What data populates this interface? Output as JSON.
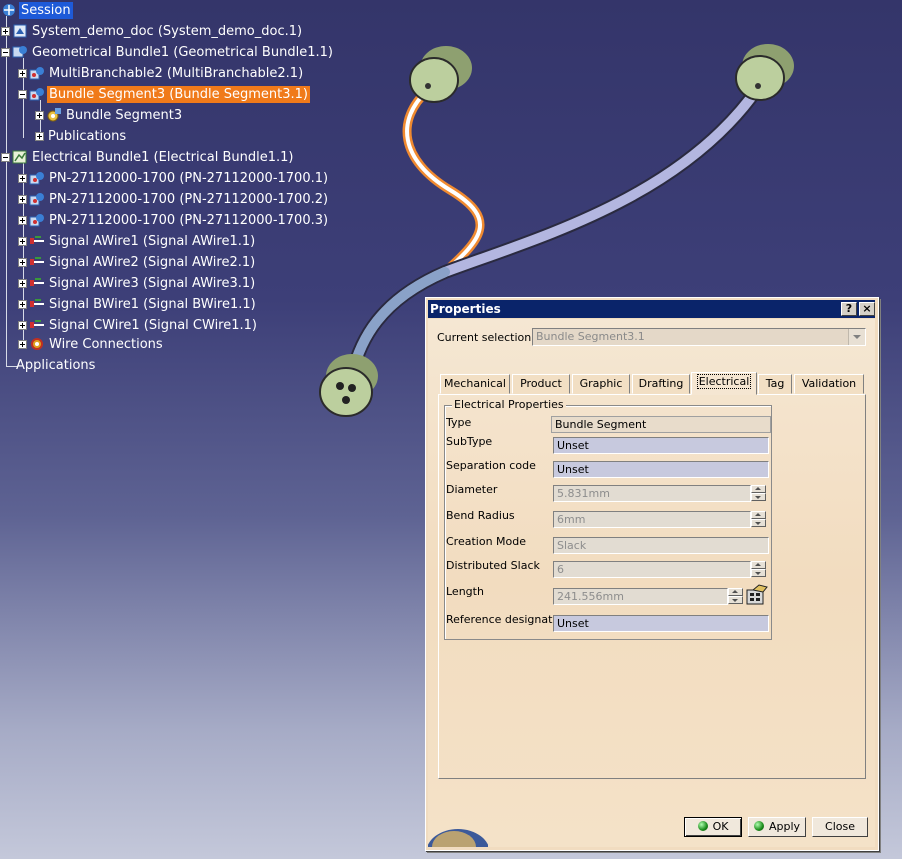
{
  "tree": {
    "root": "Session",
    "doc": "System_demo_doc (System_demo_doc.1)",
    "geo_bundle": "Geometrical Bundle1 (Geometrical Bundle1.1)",
    "multibranch": "MultiBranchable2 (MultiBranchable2.1)",
    "bundle_seg_sel": "Bundle Segment3 (Bundle Segment3.1)",
    "bundle_seg": "Bundle Segment3",
    "publications": "Publications",
    "elec_bundle": "Electrical Bundle1 (Electrical Bundle1.1)",
    "parts": [
      "PN-27112000-1700 (PN-27112000-1700.1)",
      "PN-27112000-1700 (PN-27112000-1700.2)",
      "PN-27112000-1700 (PN-27112000-1700.3)"
    ],
    "wires": [
      "Signal AWire1 (Signal AWire1.1)",
      "Signal AWire2 (Signal AWire2.1)",
      "Signal AWire3 (Signal AWire3.1)",
      "Signal BWire1 (Signal BWire1.1)",
      "Signal CWire1 (Signal CWire1.1)"
    ],
    "wire_connections": "Wire Connections",
    "applications": "Applications"
  },
  "dialog": {
    "title": "Properties",
    "help_btn": "?",
    "close_btn": "×",
    "current_selection_label": "Current selection :",
    "current_selection_value": "Bundle Segment3.1",
    "tabs": [
      "Mechanical",
      "Product",
      "Graphic",
      "Drafting",
      "Electrical",
      "Tag",
      "Validation"
    ],
    "active_tab": "Electrical",
    "group_title": "Electrical Properties",
    "fields": {
      "type_label": "Type",
      "type_value": "Bundle Segment",
      "subtype_label": "SubType",
      "subtype_value": "Unset",
      "sep_label": "Separation code",
      "sep_value": "Unset",
      "diam_label": "Diameter",
      "diam_value": "5.831mm",
      "bend_label": "Bend Radius",
      "bend_value": "6mm",
      "mode_label": "Creation Mode",
      "mode_value": "Slack",
      "slack_label": "Distributed Slack",
      "slack_value": "6",
      "length_label": "Length",
      "length_value": "241.556mm",
      "ref_label": "Reference designator",
      "ref_value": "Unset"
    },
    "buttons": {
      "ok": "OK",
      "apply": "Apply",
      "close": "Close"
    }
  },
  "colors": {
    "selection_blue": "#1e5ad8",
    "selection_orange": "#f07a1a",
    "titlebar": "#0a246a",
    "connector_green": "#b9cc9c"
  }
}
